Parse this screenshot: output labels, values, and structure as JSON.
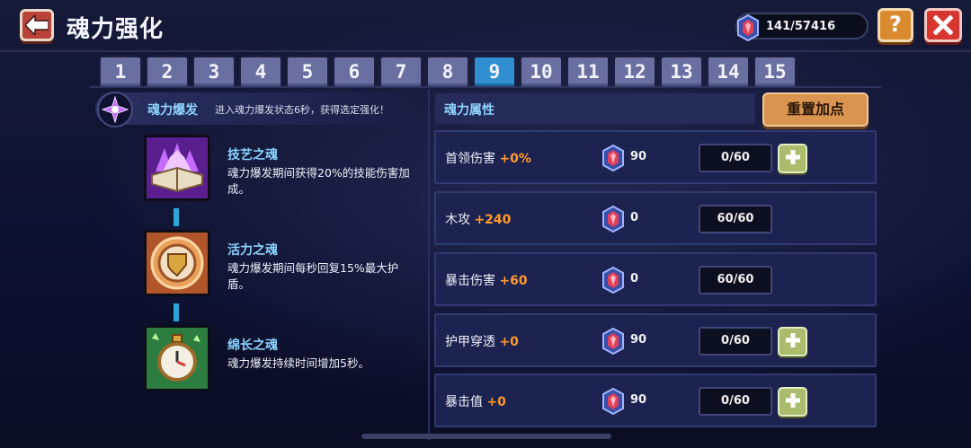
{
  "header": {
    "title": "魂力强化",
    "currency": "141/57416"
  },
  "tabs": [
    {
      "label": "1"
    },
    {
      "label": "2"
    },
    {
      "label": "3"
    },
    {
      "label": "4"
    },
    {
      "label": "5"
    },
    {
      "label": "6"
    },
    {
      "label": "7"
    },
    {
      "label": "8"
    },
    {
      "label": "9"
    },
    {
      "label": "10"
    },
    {
      "label": "11"
    },
    {
      "label": "12"
    },
    {
      "label": "13"
    },
    {
      "label": "14"
    },
    {
      "label": "15"
    }
  ],
  "active_tab": "9",
  "burst": {
    "title": "魂力爆发",
    "desc": "进入魂力爆发状态6秒，获得选定强化！"
  },
  "souls": [
    {
      "name": "技艺之魂",
      "desc": "魂力爆发期间获得20%的技能伤害加成。",
      "icon": "purple-flame-book-icon"
    },
    {
      "name": "活力之魂",
      "desc": "魂力爆发期间每秒回复15%最大护盾。",
      "icon": "shield-medal-icon"
    },
    {
      "name": "绵长之魂",
      "desc": "魂力爆发持续时间增加5秒。",
      "icon": "stopwatch-icon"
    }
  ],
  "attributes": {
    "title": "魂力属性",
    "reset_label": "重置加点",
    "rows": [
      {
        "name": "首领伤害",
        "bonus": "+0%",
        "cost": "90",
        "level": "0/60",
        "plus": true
      },
      {
        "name": "木攻",
        "bonus": "+240",
        "cost": "0",
        "level": "60/60",
        "plus": false
      },
      {
        "name": "暴击伤害",
        "bonus": "+60",
        "cost": "0",
        "level": "60/60",
        "plus": false
      },
      {
        "name": "护甲穿透",
        "bonus": "+0",
        "cost": "90",
        "level": "0/60",
        "plus": true
      },
      {
        "name": "暴击值",
        "bonus": "+0",
        "cost": "90",
        "level": "0/60",
        "plus": true
      }
    ]
  },
  "colors": {
    "accent_blue": "#8fd4ff",
    "bonus_orange": "#ff9a2e",
    "active_tab": "#2f8fd1",
    "tab": "#6a6fa2"
  }
}
